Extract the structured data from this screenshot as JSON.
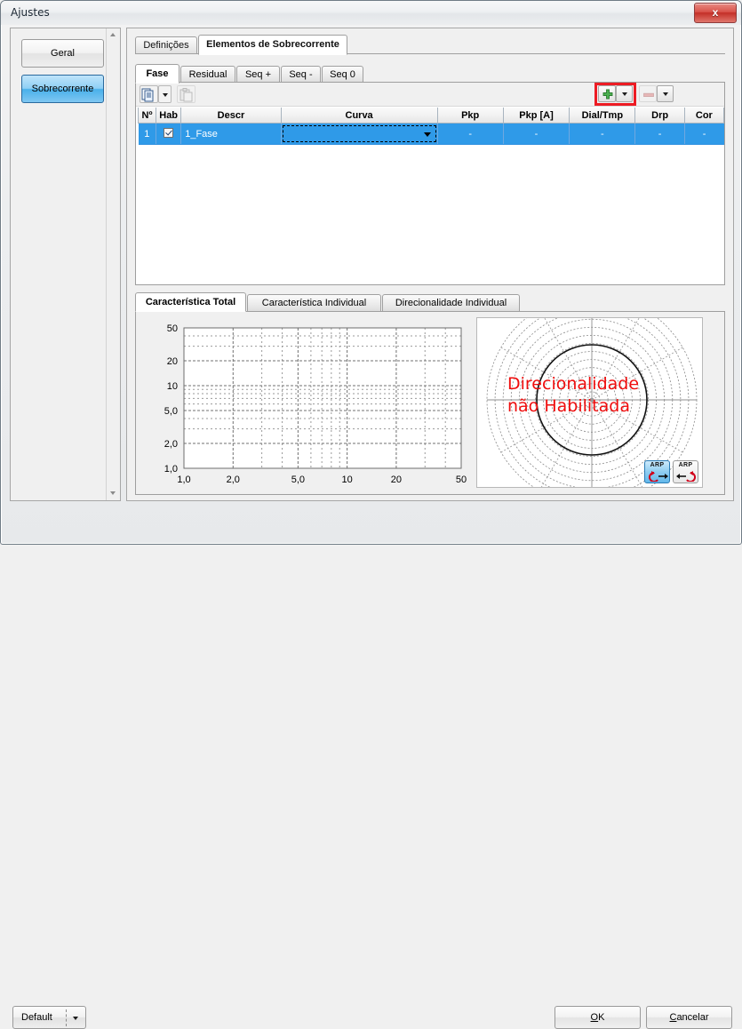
{
  "window": {
    "title": "Ajustes",
    "close_icon": "close-icon",
    "close_label": "x"
  },
  "sidebar": {
    "items": [
      {
        "label": "Geral",
        "selected": false
      },
      {
        "label": "Sobrecorrente",
        "selected": true
      }
    ],
    "scrollbar": {
      "up_icon": "scroll-up-arrow-icon",
      "down_icon": "scroll-down-arrow-icon"
    }
  },
  "outer_tabs": [
    {
      "label": "Definições",
      "active": false
    },
    {
      "label": "Elementos de Sobrecorrente",
      "active": true
    }
  ],
  "inner_tabs": [
    {
      "label": "Fase",
      "active": true
    },
    {
      "label": "Residual",
      "active": false
    },
    {
      "label": "Seq +",
      "active": false
    },
    {
      "label": "Seq -",
      "active": false
    },
    {
      "label": "Seq 0",
      "active": false
    }
  ],
  "grid_toolbar": {
    "copy_icon": "copy-icon",
    "copy_dropdown_icon": "chevron-down-icon",
    "paste_icon": "paste-icon",
    "add_icon": "plus-icon",
    "add_dropdown_icon": "chevron-down-icon",
    "remove_icon": "minus-icon",
    "remove_dropdown_icon": "chevron-down-icon",
    "highlight_color": "#ed1c24"
  },
  "table": {
    "columns": [
      "Nº",
      "Hab",
      "Descr",
      "Curva",
      "Pkp",
      "Pkp [A]",
      "Dial/Tmp",
      "Drp",
      "Cor"
    ],
    "rows": [
      {
        "num": "1",
        "hab_checked": true,
        "descr": "1_Fase",
        "curva": "",
        "pkp": "-",
        "pkp_a": "-",
        "dial_tmp": "-",
        "drp": "-",
        "cor": "-",
        "selected": true
      }
    ],
    "selection_color": "#2f9ae8"
  },
  "chart_tabs": [
    {
      "label": "Característica Total",
      "active": true
    },
    {
      "label": "Característica Individual",
      "active": false
    },
    {
      "label": "Direcionalidade Individual",
      "active": false
    }
  ],
  "chart_data": {
    "type": "line",
    "title": "",
    "xlabel": "",
    "ylabel": "",
    "xscale": "log",
    "yscale": "log",
    "xlim": [
      1.0,
      50.0
    ],
    "ylim": [
      1.0,
      50.0
    ],
    "xticks": [
      1.0,
      2.0,
      5.0,
      10.0,
      20.0,
      50.0
    ],
    "xtick_labels": [
      "1,0",
      "2,0",
      "5,0",
      "10",
      "20",
      "50"
    ],
    "yticks": [
      1.0,
      2.0,
      5.0,
      10.0,
      20.0,
      50.0
    ],
    "ytick_labels": [
      "1,0",
      "2,0",
      "5,0",
      "10",
      "20",
      "50"
    ],
    "grid": true,
    "minor_grid": true,
    "legend": false,
    "series": []
  },
  "polar": {
    "type": "polar",
    "message_line1": "Direcionalidade",
    "message_line2": "não Habilitada",
    "message_color": "#ef0c0c",
    "radial_rings": 9,
    "angular_spokes": 12,
    "characteristic_circle": true
  },
  "arp_buttons": [
    {
      "label": "ARP",
      "icon": "arp-rotate-left-icon",
      "active": true
    },
    {
      "label": "ARP",
      "icon": "arp-rotate-right-icon",
      "active": false
    }
  ],
  "footer": {
    "default_label": "Default",
    "default_dropdown_icon": "chevron-down-icon",
    "ok_label": "OK",
    "ok_accel": "O",
    "cancel_label": "Cancelar",
    "cancel_accel": "C"
  }
}
